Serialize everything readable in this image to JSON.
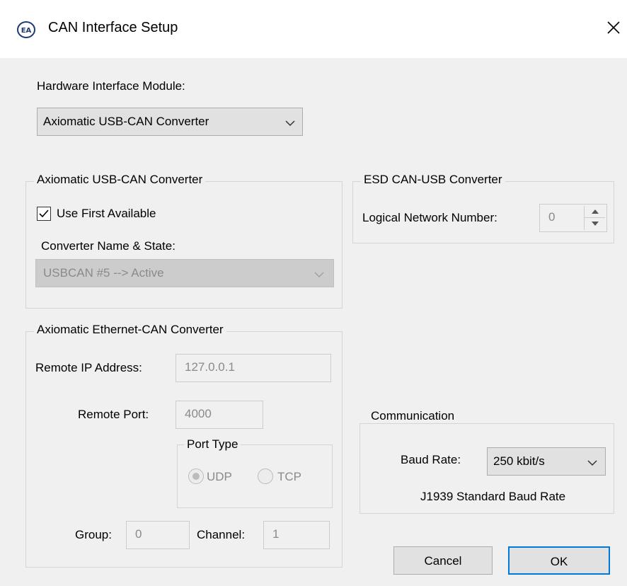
{
  "window": {
    "title": "CAN Interface Setup"
  },
  "hardware": {
    "label": "Hardware Interface Module:",
    "selected": "Axiomatic USB-CAN Converter"
  },
  "usb_group": {
    "title": "Axiomatic USB-CAN Converter",
    "use_first_label": "Use First Available",
    "use_first_checked": true,
    "converter_label": "Converter Name & State:",
    "converter_value": "USBCAN #5  --> Active"
  },
  "esd_group": {
    "title": "ESD CAN-USB Converter",
    "lnn_label": "Logical Network Number:",
    "lnn_value": "0"
  },
  "eth_group": {
    "title": "Axiomatic Ethernet-CAN Converter",
    "ip_label": "Remote IP Address:",
    "ip_value": "127.0.0.1",
    "port_label": "Remote Port:",
    "port_value": "4000",
    "port_type": {
      "title": "Port Type",
      "udp_label": "UDP",
      "tcp_label": "TCP",
      "selected": "UDP"
    },
    "group_label": "Group:",
    "group_value": "0",
    "channel_label": "Channel:",
    "channel_value": "1"
  },
  "comm_group": {
    "title": "Communication",
    "baud_label": "Baud Rate:",
    "baud_value": "250 kbit/s",
    "baud_note": "J1939 Standard Baud Rate"
  },
  "buttons": {
    "cancel": "Cancel",
    "ok": "OK"
  },
  "colors": {
    "accent": "#0078d7",
    "window_bg": "#f0f0f0",
    "disabled_text": "#8a8a8a"
  }
}
